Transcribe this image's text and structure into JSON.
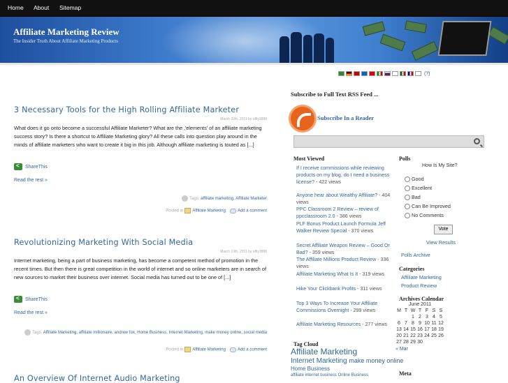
{
  "nav": {
    "home": "Home",
    "about": "About",
    "sitemap": "Sitemap"
  },
  "header": {
    "title": "Affiliate Marketing Review",
    "tagline": "The Insider Truth About Affiliate Marketing Products"
  },
  "posts": [
    {
      "title": "3 Necessary Tools for the High Rolling Affiliate Marketer",
      "meta": "March 20th, 2011 by affiy3888",
      "body": "What does it go onto become a successful Affiliate Marketer? What are the ‚'elements' of an affiliate marketing success story? Is there a shortcut to Affiliate Marketing glory? All these calls into question play around in the minds of affiliate marketers who want to create it big in this job. Although affiliate marketing is touted as [...]",
      "share": "ShareThis",
      "readmore": "Read the rest »",
      "tags_label": "Tags:",
      "tags": "affiliate marketing, Affiliate Marketer",
      "posted_in": "Posted in",
      "category": "Affiliate Marketing",
      "comment": "Add a comment"
    },
    {
      "title": "Revolutionizing Marketing With Social Media",
      "meta": "March 19th, 2011 by affiy3888",
      "body": "Internet marketing, being a part of business marketing, has become a competent method of promotion in the recent times. But then there is great competition in the world of internet and so online marketers are in search of new sources to market their business over internet. Social media has turned out to be one of [...]",
      "share": "ShareThis",
      "readmore": "Read the rest »",
      "tags_label": "Tags:",
      "tags": "Affiliate Marketing, affiliate millionaire, andrew fox, Home Business, Internet Marketing, make money online, social media",
      "posted_in": "Posted in",
      "category": "Affiliate Marketing",
      "comment": "Add a comment"
    },
    {
      "title": "An Overview Of Internet Audio Marketing"
    }
  ],
  "sidebar": {
    "translate_help": "(?)",
    "subscribe_heading": "Subscribe to Full Text RSS Feed ...",
    "subscribe_link": "Subscribe In a Reader",
    "most_viewed_heading": "Most Viewed",
    "most_viewed": [
      {
        "title": "If I receive commissions while reviewing products on my blog, do I need a business license?",
        "views": "- 422 views"
      },
      {
        "title": "Anyone hear about Wealthy Affiliate?",
        "views": "- 404 views"
      },
      {
        "title": "PPC Classroom 2 Review – review of ppcclassroom 2.0",
        "views": "- 386 views"
      },
      {
        "title": "PLF Bonus Product Launch Formula Jeff Walker Review Special",
        "views": "- 370 views"
      },
      {
        "title": "Secret Affiliate Weapon Review – Good Or Bad?",
        "views": "- 359 views"
      },
      {
        "title": "The Affiliate Millions Product Review",
        "views": "- 336 views"
      },
      {
        "title": "Affiliate Marketing What Is It",
        "views": "- 319 views"
      },
      {
        "title": "Hike Your Clickbank Profits",
        "views": "- 311 views"
      },
      {
        "title": "Top 3 Ways To Increase Your Affiliate Commissions Overnight",
        "views": "- 299 views"
      },
      {
        "title": "Affiliate Marketing Resources",
        "views": "- 277 views"
      }
    ],
    "polls_heading": "Polls",
    "poll_question": "How Is My Site?",
    "poll_options": [
      "Good",
      "Excellent",
      "Bad",
      "Can Be Improved",
      "No Comments"
    ],
    "vote_label": "Vote",
    "view_results": "View Results",
    "polls_archive": "Polls Archive",
    "categories_heading": "Categories",
    "categories": [
      "Affiliate Marketing",
      "Product Review"
    ],
    "archives_heading": "Archives Calendar",
    "calendar_month": "June 2011",
    "calendar_days": [
      "M",
      "T",
      "W",
      "T",
      "F",
      "S",
      "S"
    ],
    "calendar_rows": [
      [
        "",
        "",
        "1",
        "2",
        "3",
        "4",
        "5"
      ],
      [
        "6",
        "7",
        "8",
        "9",
        "10",
        "11",
        "12"
      ],
      [
        "13",
        "14",
        "15",
        "16",
        "17",
        "18",
        "19"
      ],
      [
        "20",
        "21",
        "22",
        "23",
        "24",
        "25",
        "26"
      ],
      [
        "27",
        "28",
        "29",
        "30",
        "",
        "",
        ""
      ]
    ],
    "calendar_prev": "« Mar",
    "meta_heading": "Meta",
    "tag_cloud_heading": "Tag Cloud",
    "tag_cloud": [
      "Affiliate Marketing",
      "Internet Marketing",
      "make money online",
      "Home Business",
      "affiliate internet business",
      "Online Business"
    ]
  }
}
